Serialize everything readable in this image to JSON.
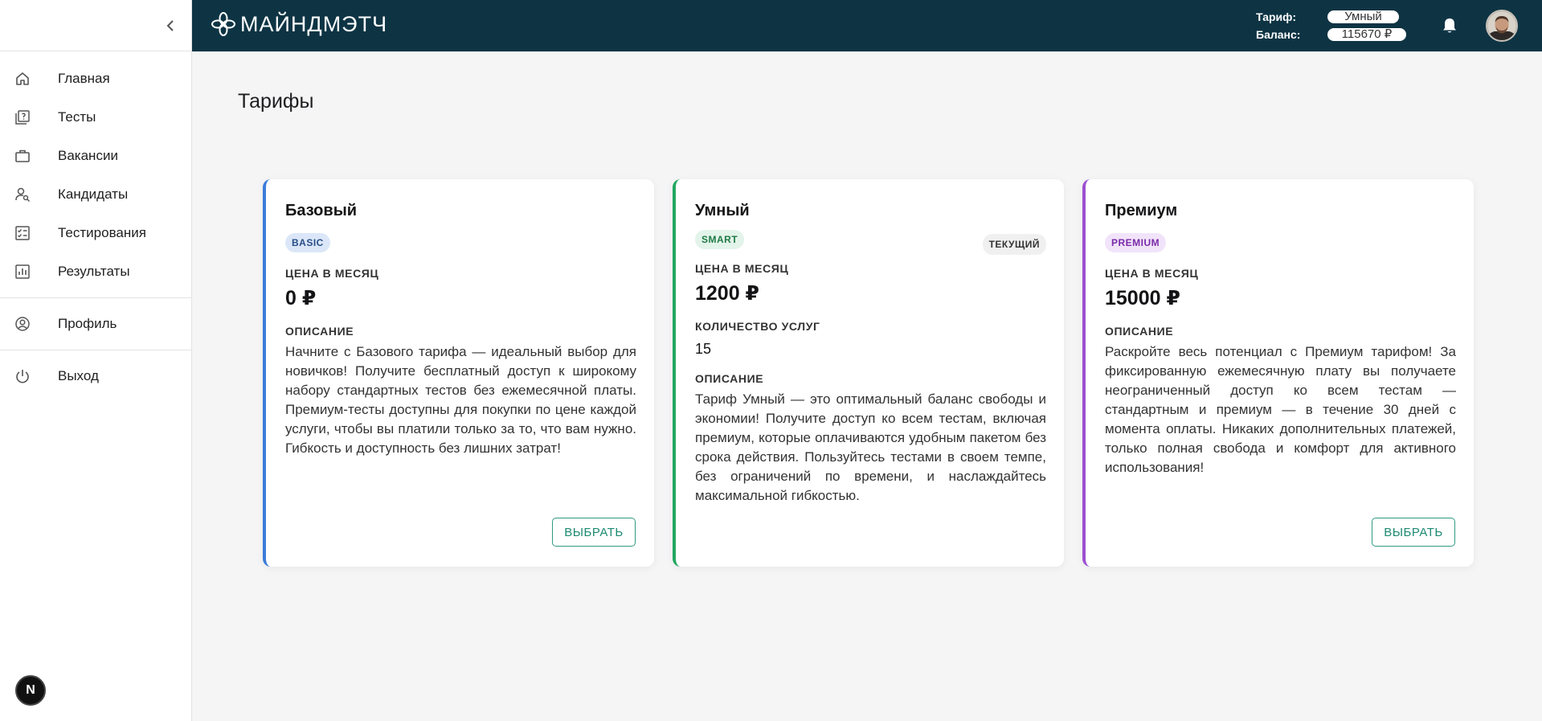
{
  "app": {
    "brand": "МАЙНДМЭТЧ"
  },
  "sidebar": {
    "items": [
      {
        "label": "Главная",
        "icon": "home-icon"
      },
      {
        "label": "Тесты",
        "icon": "tests-icon"
      },
      {
        "label": "Вакансии",
        "icon": "briefcase-icon"
      },
      {
        "label": "Кандидаты",
        "icon": "candidates-icon"
      },
      {
        "label": "Тестирования",
        "icon": "checklist-icon"
      },
      {
        "label": "Результаты",
        "icon": "bar-chart-icon"
      },
      {
        "label": "Профиль",
        "icon": "profile-icon"
      },
      {
        "label": "Выход",
        "icon": "power-icon"
      }
    ],
    "badge": "N"
  },
  "header": {
    "tariff_label": "Тариф:",
    "tariff_value": "Умный",
    "balance_label": "Баланс:",
    "balance_value": "115670 ₽"
  },
  "page": {
    "title": "Тарифы"
  },
  "cards": [
    {
      "name": "Базовый",
      "tag": "BASIC",
      "accent": "#3b7bd9",
      "price_label": "ЦЕНА В МЕСЯЦ",
      "price": "0 ₽",
      "desc_label": "ОПИСАНИЕ",
      "description": "Начните с Базового тарифа — идеальный выбор для новичков! Получите бесплатный доступ к широкому набору стандартных тестов без ежемесячной платы. Премиум-тесты доступны для покупки по цене каждой услуги, чтобы вы платили только за то, что вам нужно. Гибкость и доступность без лишних затрат!",
      "button": "ВЫБРАТЬ"
    },
    {
      "name": "Умный",
      "tag": "SMART",
      "current": "ТЕКУЩИЙ",
      "accent": "#22a85f",
      "price_label": "ЦЕНА В МЕСЯЦ",
      "price": "1200 ₽",
      "count_label": "КОЛИЧЕСТВО УСЛУГ",
      "count": "15",
      "desc_label": "ОПИСАНИЕ",
      "description": "Тариф Умный — это оптимальный баланс свободы и экономии! Получите доступ ко всем тестам, включая премиум, которые оплачиваются удобным пакетом без срока действия. Пользуйтесь тестами в своем темпе, без ограничений по времени, и наслаждайтесь максимальной гибкостью."
    },
    {
      "name": "Премиум",
      "tag": "PREMIUM",
      "accent": "#9b4fd1",
      "price_label": "ЦЕНА В МЕСЯЦ",
      "price": "15000 ₽",
      "desc_label": "ОПИСАНИЕ",
      "description": "Раскройте весь потенциал с Премиум тарифом! За фиксированную ежемесячную плату вы получаете неограниченный доступ ко всем тестам — стандартным и премиум — в течение 30 дней с момента оплаты. Никаких дополнительных платежей, только полная свобода и комфорт для активного использования!",
      "button": "ВЫБРАТЬ"
    }
  ]
}
